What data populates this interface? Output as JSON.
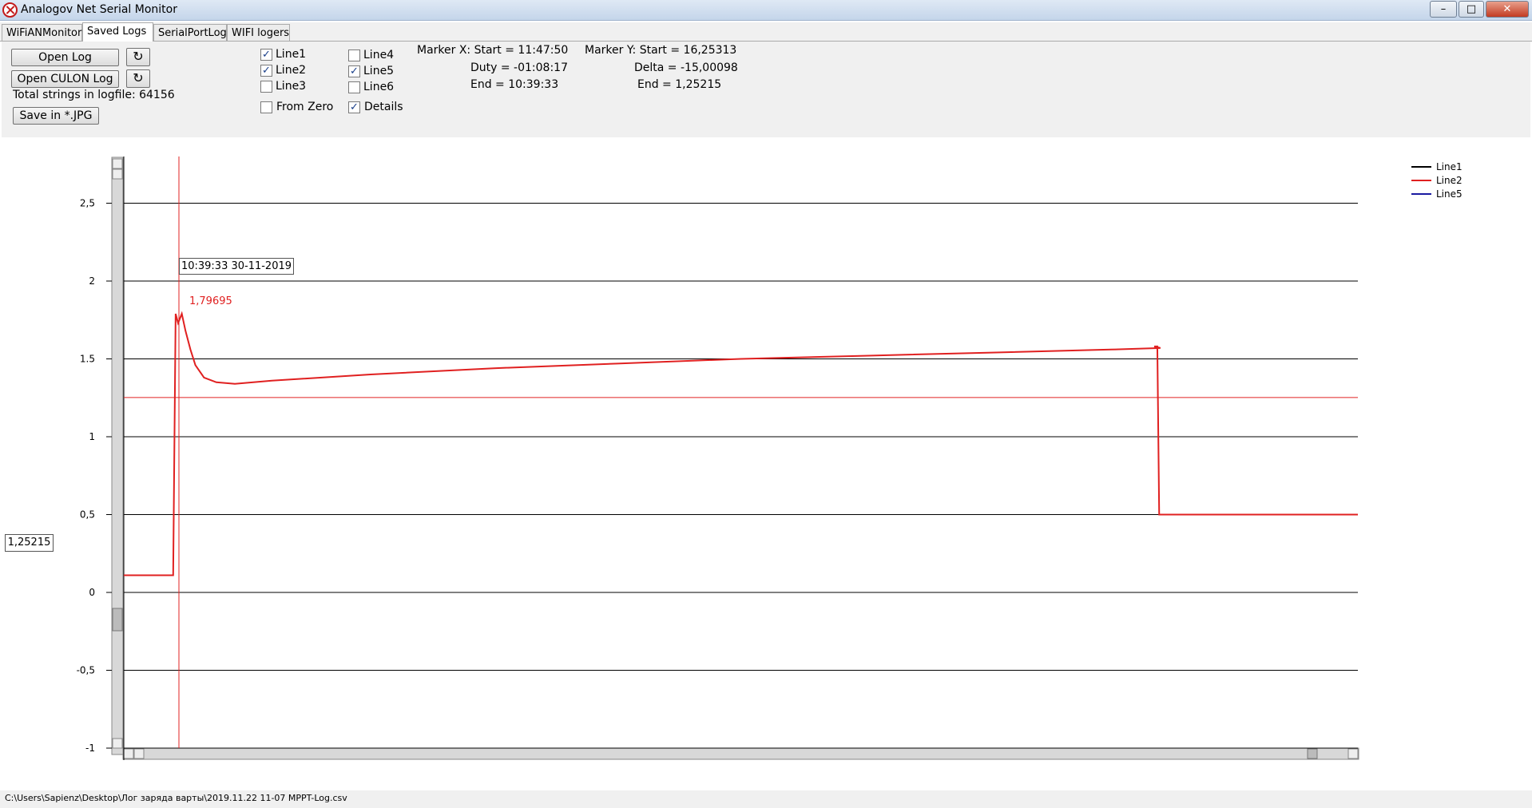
{
  "window": {
    "title": "Analogov Net Serial Monitor",
    "controls": {
      "minimize": "–",
      "maximize": "□",
      "close": "✕"
    }
  },
  "tabs": [
    {
      "label": "WiFiANMonitor"
    },
    {
      "label": "Saved Logs"
    },
    {
      "label": "SerialPortLog"
    },
    {
      "label": "WIFI logers"
    }
  ],
  "panel": {
    "open_log": "Open Log",
    "open_culon_log": "Open CULON Log",
    "refresh_icon": "↻",
    "total_strings": "Total strings in logfile: 64156",
    "save_jpg": "Save in *.JPG",
    "checks": {
      "line1": {
        "label": "Line1",
        "checked": true
      },
      "line2": {
        "label": "Line2",
        "checked": true
      },
      "line3": {
        "label": "Line3",
        "checked": false
      },
      "line4": {
        "label": "Line4",
        "checked": false
      },
      "line5": {
        "label": "Line5",
        "checked": true
      },
      "line6": {
        "label": "Line6",
        "checked": false
      },
      "from_zero": {
        "label": "From Zero",
        "checked": false
      },
      "details": {
        "label": "Details",
        "checked": true
      }
    },
    "marker_x": {
      "start": "Marker X: Start = 11:47:50",
      "duty": "Duty = -01:08:17",
      "end": "End  = 10:39:33"
    },
    "marker_y": {
      "start": "Marker Y: Start = 16,25313",
      "delta": "Delta = -15,00098",
      "end": "End  = 1,25215"
    },
    "time_marker": "10:39:33 30-11-2019"
  },
  "cursor_y_value": "1,25215",
  "status_path": "C:\\Users\\Sapienz\\Desktop\\Лог заряда варты\\2019.11.22 11-07 MPPT-Log.csv",
  "chart_data": {
    "type": "line",
    "ylim": [
      -1,
      2.8
    ],
    "y_ticks": [
      "2,5",
      "2",
      "1.5",
      "1",
      "0,5",
      "0",
      "-0,5",
      "-1"
    ],
    "y_tick_values": [
      2.5,
      2,
      1.5,
      1,
      0.5,
      0,
      -0.5,
      -1
    ],
    "grid": true,
    "legend": [
      "Line1",
      "Line2",
      "Line5"
    ],
    "legend_colors": [
      "#000000",
      "#e02020",
      "#1a1aa0"
    ],
    "legend_position": "top-right",
    "peak_label": "1,79695",
    "marker_y_value": 1.252,
    "series": [
      {
        "name": "Line2",
        "color": "#e02020",
        "x": [
          0,
          0.04,
          0.042,
          0.044,
          0.047,
          0.05,
          0.054,
          0.058,
          0.065,
          0.075,
          0.09,
          0.12,
          0.2,
          0.3,
          0.4,
          0.5,
          0.6,
          0.7,
          0.8,
          0.84,
          0.835,
          0.8375,
          0.839,
          1.0
        ],
        "y": [
          0.11,
          0.11,
          1.79,
          1.73,
          1.79,
          1.68,
          1.56,
          1.46,
          1.38,
          1.35,
          1.34,
          1.36,
          1.4,
          1.44,
          1.47,
          1.5,
          1.52,
          1.54,
          1.56,
          1.57,
          1.58,
          1.58,
          0.5,
          0.5
        ]
      }
    ]
  }
}
